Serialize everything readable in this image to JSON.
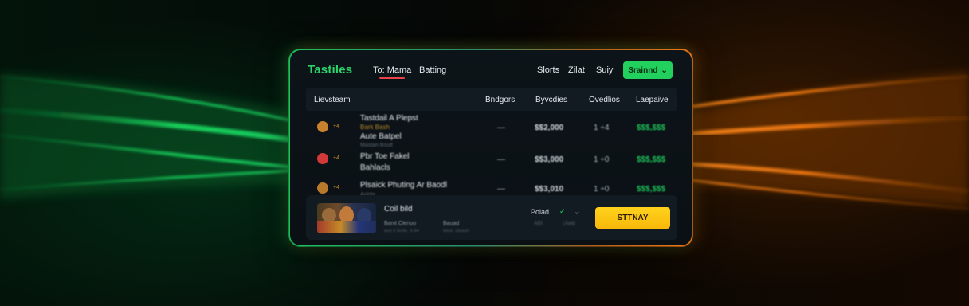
{
  "header": {
    "brand": "Tastiles",
    "nav": [
      "To: Mama",
      "Batting"
    ],
    "links": [
      "Slorts",
      "Zilat",
      "Suiy"
    ],
    "cta_label": "Srainnd"
  },
  "table": {
    "columns": [
      "Lievsteam",
      "Bndgors",
      "Byvcdies",
      "Ovedlios",
      "Laepaive"
    ],
    "rows": [
      {
        "title": "Tastdail A Plepst",
        "subtitle": "Bark Bash",
        "extra": "Aute Batpel",
        "meta": "Mastan Bsutt",
        "dash": "—",
        "value": "$$2,000",
        "ratio": "1 ÷4",
        "green": "$$$,$$$",
        "avatar_color": "#c8822e"
      },
      {
        "title": "Pbr Toe Fakel",
        "subtitle": "",
        "extra": "Bahlacls",
        "meta": "",
        "dash": "—",
        "value": "$$3,000",
        "ratio": "1 ÷0",
        "green": "$$$,$$$",
        "avatar_color": "#d23a3a"
      },
      {
        "title": "Plsaick Phuting Ar Baodl",
        "subtitle": "",
        "extra": "",
        "meta": "Aotrbr",
        "dash": "—",
        "value": "$$3,010",
        "ratio": "1 ÷0",
        "green": "$$$,$$$",
        "avatar_color": "#b87a2a"
      }
    ]
  },
  "bottom": {
    "title": "Coil bild",
    "label1": "Banit Clenuo",
    "label2": "Bauad",
    "sub1": "Bicl lt Bclle. 9.44",
    "sub2": "Blod. Deaon",
    "played_label": "Polad",
    "played_sub1": "ABI",
    "played_sub2": "Ulaib",
    "play_button": "STTNAY"
  },
  "colors": {
    "brand_green": "#2ad36a",
    "accent_orange": "#f07a16",
    "cta_green": "#22d05e",
    "play_yellow": "#ffd21c",
    "nav_underline": "#e8434a"
  },
  "icons": {
    "cta": "chevron-down-icon",
    "played_check": "check-icon",
    "played_chevron": "chevron-down-icon"
  }
}
